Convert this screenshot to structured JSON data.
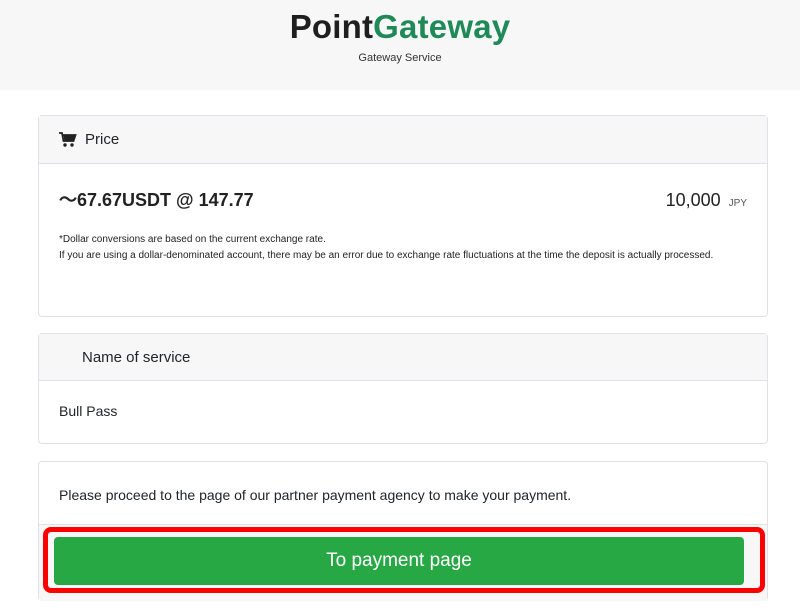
{
  "header": {
    "brand_part1": "Point",
    "brand_part2": "Gateway",
    "subtitle": "Gateway Service"
  },
  "price_card": {
    "title": "Price",
    "icon": "cart-icon",
    "usdt_text": "～67.67USDT @ 147.77",
    "jpy_amount": "10,000",
    "jpy_unit": "JPY",
    "note_line1": "*Dollar conversions are based on the current exchange rate.",
    "note_line2": "If you are using a dollar-denominated account, there may be an error due to exchange rate fluctuations at the time the deposit is actually processed."
  },
  "service_card": {
    "title": "Name of service",
    "service_name": "Bull Pass"
  },
  "pay_card": {
    "message": "Please proceed to the page of our partner payment agency to make your payment.",
    "button_label": "To payment page"
  },
  "colors": {
    "brand_green": "#1f8a58",
    "button_green": "#28a745",
    "highlight_red": "#ff0000"
  }
}
